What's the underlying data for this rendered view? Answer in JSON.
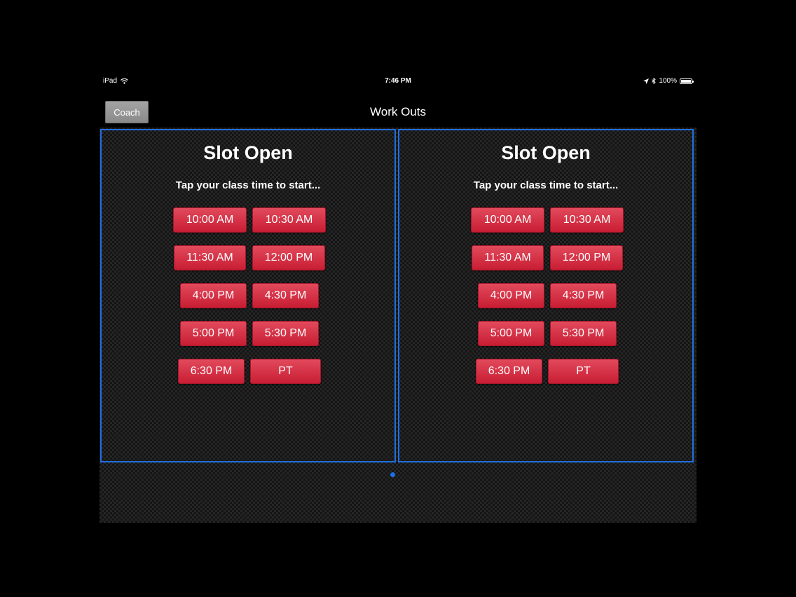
{
  "status_bar": {
    "device": "iPad",
    "time": "7:46 PM",
    "battery": "100%",
    "battery_level": 1.0
  },
  "nav": {
    "title": "Work Outs",
    "coach_label": "Coach"
  },
  "panels": [
    {
      "title": "Slot Open",
      "subtitle": "Tap your class time to start...",
      "times": [
        "10:00 AM",
        "10:30 AM",
        "11:30 AM",
        "12:00 PM",
        "4:00 PM",
        "4:30 PM",
        "5:00 PM",
        "5:30 PM",
        "6:30 PM",
        "PT"
      ]
    },
    {
      "title": "Slot Open",
      "subtitle": "Tap your class time to start...",
      "times": [
        "10:00 AM",
        "10:30 AM",
        "11:30 AM",
        "12:00 PM",
        "4:00 PM",
        "4:30 PM",
        "5:00 PM",
        "5:30 PM",
        "6:30 PM",
        "PT"
      ]
    }
  ],
  "page_indicator": {
    "pages": 1,
    "current": 1
  },
  "colors": {
    "accent_blue": "#1f6fe0",
    "button_red": "#d12a3e"
  }
}
